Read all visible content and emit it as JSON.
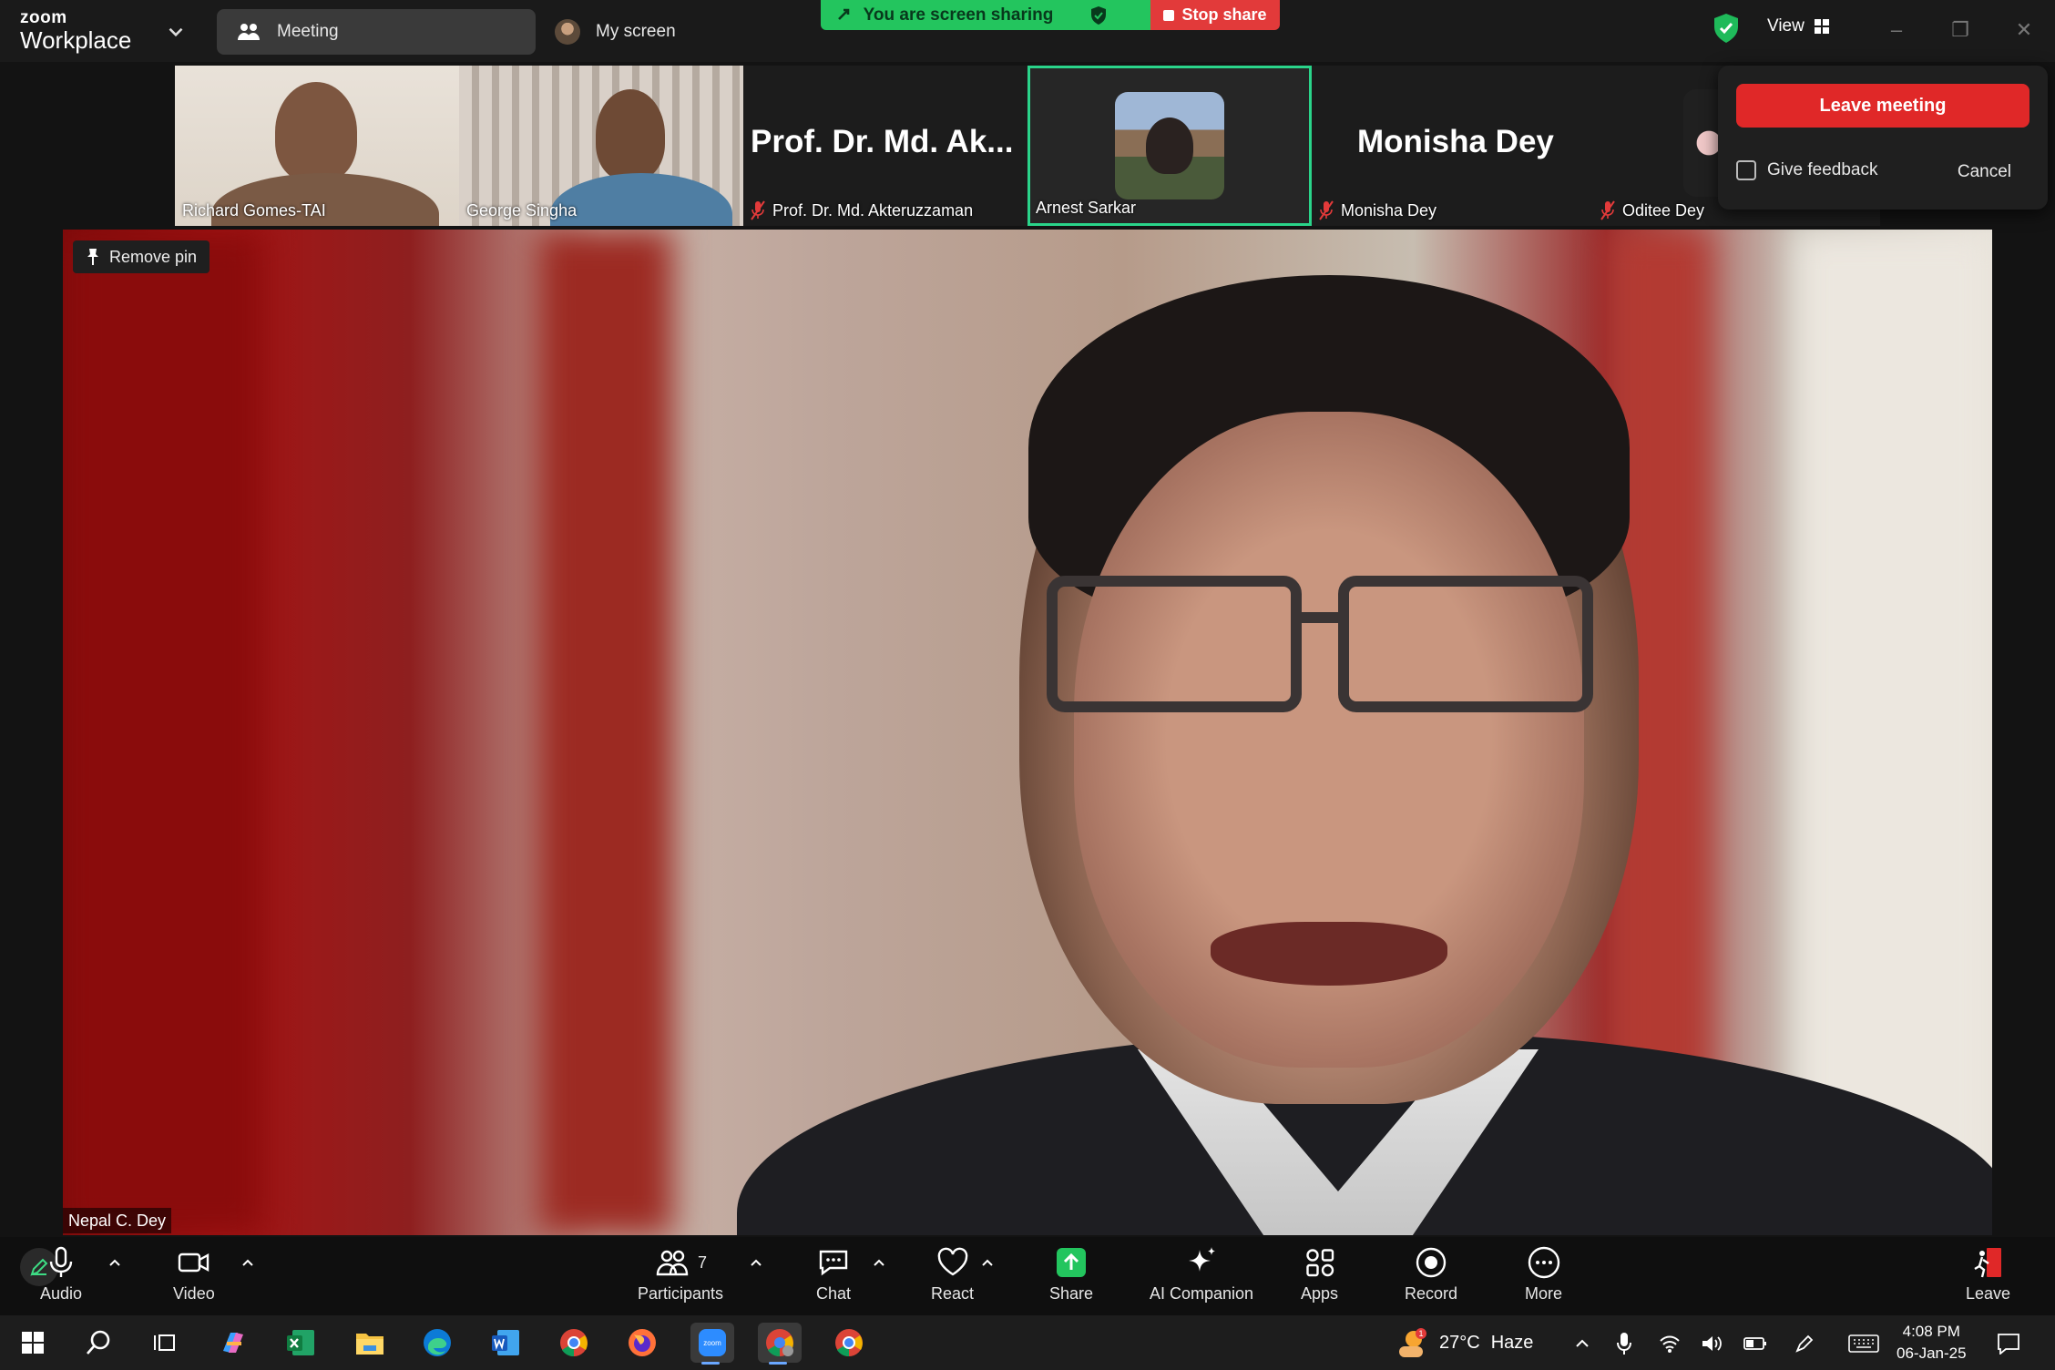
{
  "app": {
    "brand_small": "zoom",
    "brand_big": "Workplace"
  },
  "tabs": {
    "meeting": "Meeting",
    "my_screen": "My screen"
  },
  "share_banner": {
    "status": "You are screen sharing",
    "stop": "Stop share"
  },
  "view": {
    "label": "View"
  },
  "participants_strip": [
    {
      "name": "Richard Gomes-TAI",
      "muted": false,
      "video": true
    },
    {
      "name": "George Singha",
      "muted": false,
      "video": true
    },
    {
      "name": "Prof. Dr. Md. Akteruzzaman",
      "display_name": "Prof. Dr. Md. Ak...",
      "muted": true,
      "video": false
    },
    {
      "name": "Arnest Sarkar",
      "muted": false,
      "video": false,
      "active": true
    },
    {
      "name": "Monisha Dey",
      "display_name": "Monisha Dey",
      "muted": true,
      "video": false
    },
    {
      "name": "Oditee Dey",
      "muted": true,
      "video": false
    }
  ],
  "leave_popup": {
    "leave_button": "Leave meeting",
    "feedback": "Give feedback",
    "cancel": "Cancel"
  },
  "main_video": {
    "pin_label": "Remove pin",
    "speaker_name": "Nepal C. Dey"
  },
  "toolbar": {
    "audio": "Audio",
    "video": "Video",
    "participants": "Participants",
    "participants_count": "7",
    "chat": "Chat",
    "react": "React",
    "share": "Share",
    "ai_companion": "AI Companion",
    "apps": "Apps",
    "record": "Record",
    "more": "More",
    "leave": "Leave"
  },
  "taskbar": {
    "weather_temp": "27°C",
    "weather_desc": "Haze",
    "weather_badge": "1",
    "time": "4:08 PM",
    "date": "06-Jan-25"
  },
  "colors": {
    "share_green": "#23c55e",
    "danger_red": "#e02828",
    "active_border": "#2ad48a"
  }
}
